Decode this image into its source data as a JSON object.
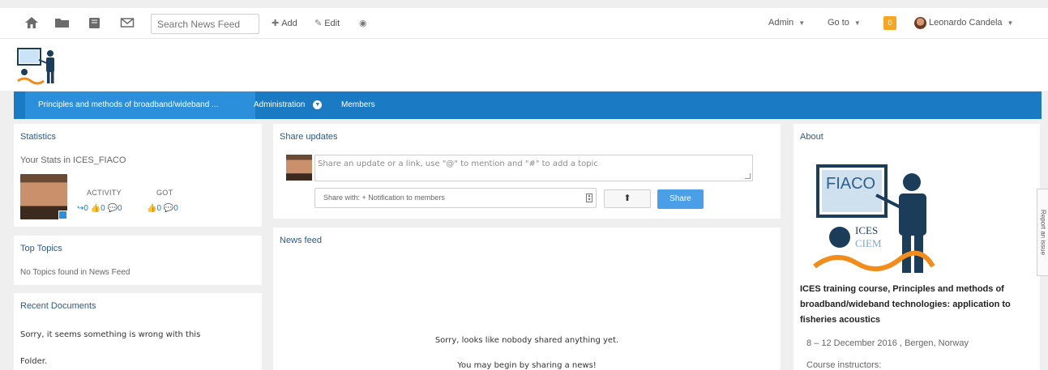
{
  "topbar": {
    "icons": [
      "home-icon",
      "folder-icon",
      "books-icon",
      "envelope-icon"
    ],
    "search_placeholder": "Search News Feed",
    "add_label": "Add",
    "edit_label": "Edit",
    "admin_label": "Admin",
    "goto_label": "Go to",
    "notification_count": "0",
    "user_name": "Leonardo Candela"
  },
  "nav": {
    "active_label": "Principles and methods of broadband/wideband ...",
    "administration_label": "Administration",
    "members_label": "Members",
    "color": "#1a7ac4"
  },
  "statistics": {
    "title": "Statistics",
    "subtitle": "Your Stats in ICES_FIACO",
    "activity_label": "ACTIVITY",
    "got_label": "GOT",
    "activity_values": "↪0 👍0 💬0",
    "got_values": "👍0 💬0"
  },
  "top_topics": {
    "title": "Top Topics",
    "empty_text": "No Topics found in News Feed"
  },
  "recent_documents": {
    "title": "Recent Documents",
    "error_line1": "Sorry, it seems something is wrong with this",
    "error_line2": "Folder."
  },
  "share_updates": {
    "title": "Share updates",
    "placeholder": "Share an update or a link, use \"@\" to mention and \"#\" to add a topic",
    "share_with": "Share with: + Notification to members",
    "share_button": "Share"
  },
  "news_feed": {
    "title": "News feed",
    "empty_line1": "Sorry, looks like nobody shared anything yet.",
    "empty_line2": "You may begin by sharing a news!"
  },
  "about": {
    "title": "About",
    "logo_text": "FIACO",
    "logo_org1": "ICES",
    "logo_org2": "CIEM",
    "course_title": "ICES training course, Principles and methods of broadband/wideband technologies: application to fisheries acoustics",
    "dates": "8 – 12 December 2016 , Bergen, Norway",
    "instructors_label": "Course instructors:"
  },
  "report_issue": "Report an issue"
}
